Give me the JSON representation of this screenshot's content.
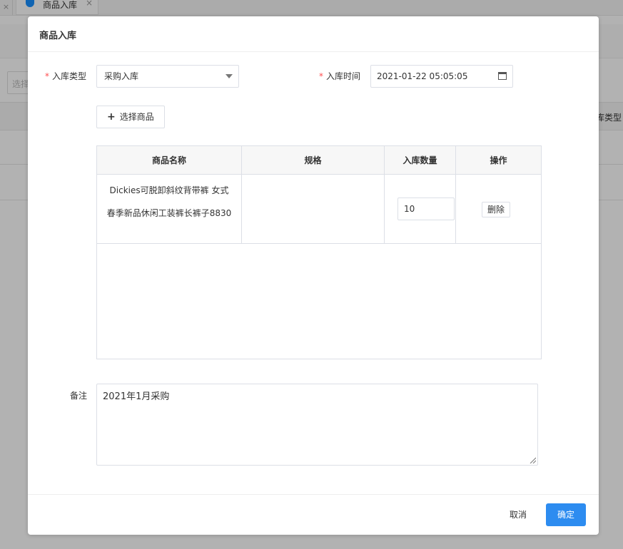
{
  "background": {
    "tab_close_left": "×",
    "tab_label": "商品入库",
    "tab_close": "×",
    "filter_placeholder": "选择",
    "table_head_label": "库类型"
  },
  "dialog": {
    "title": "商品入库",
    "stock_type": {
      "label": "入库类型",
      "required_mark": "*",
      "value": "采购入库"
    },
    "stock_time": {
      "label": "入库时间",
      "required_mark": "*",
      "value": "2021-01-22 05:05:05"
    },
    "select_goods_button": {
      "icon": "plus-icon",
      "plus": "+",
      "label": "选择商品"
    },
    "table": {
      "columns": [
        "商品名称",
        "规格",
        "入库数量",
        "操作"
      ],
      "rows": [
        {
          "name": "Dickies可脱卸斜纹背带裤 女式春季新品休闲工装裤长裤子8830",
          "spec": "",
          "quantity": "10",
          "action": "删除"
        }
      ]
    },
    "remark": {
      "label": "备注",
      "value": "2021年1月采购"
    },
    "footer": {
      "cancel": "取消",
      "confirm": "确定"
    }
  },
  "colors": {
    "primary": "#2d8cf0",
    "required": "#ff4d4f",
    "overlay": "rgba(0,0,0,0.3)"
  }
}
